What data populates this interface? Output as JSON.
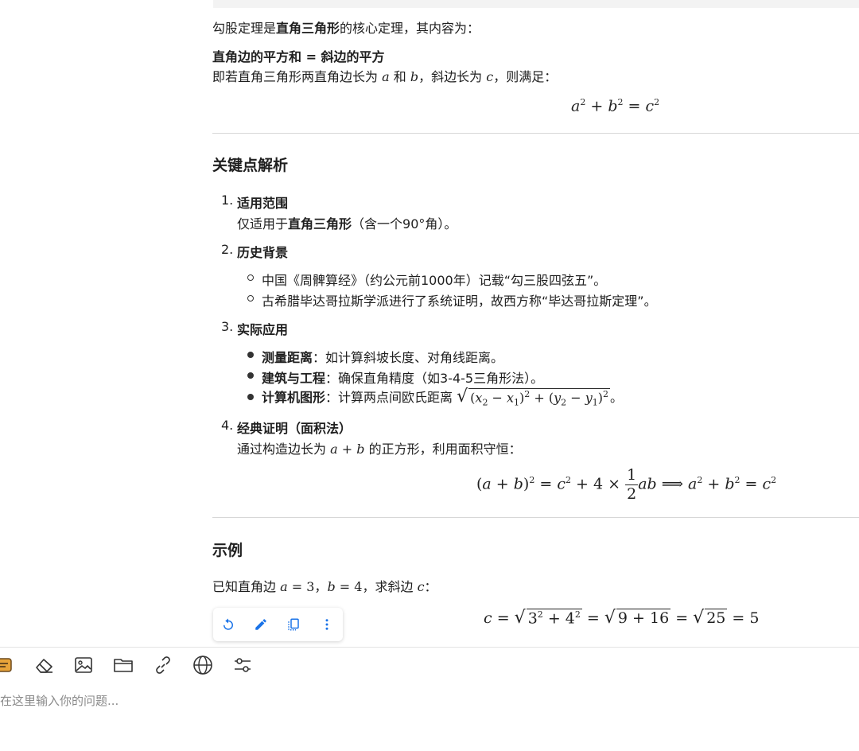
{
  "intro": {
    "prefix": "勾股定理是",
    "bold": "直角三角形",
    "suffix": "的核心定理，其内容为："
  },
  "statement": {
    "bold": "直角边的平方和 = 斜边的平方",
    "line_prefix": "即若直角三角形两直角边长为",
    "and": "和",
    "hyp": "，斜边长为",
    "end": "，则满足："
  },
  "sections": {
    "key_points": "关键点解析",
    "example": "示例"
  },
  "items": [
    {
      "num": "1.",
      "title": "适用范围",
      "desc_prefix": "仅适用于",
      "desc_bold": "直角三角形",
      "desc_suffix": "（含一个90°角）。"
    },
    {
      "num": "2.",
      "title": "历史背景",
      "bullets": [
        "中国《周髀算经》（约公元前1000年）记载“勾三股四弦五”。",
        "古希腊毕达哥拉斯学派进行了系统证明，故西方称“毕达哥拉斯定理”。"
      ]
    },
    {
      "num": "3.",
      "title": "实际应用",
      "bullets": [
        {
          "bold": "测量距离",
          "text": "：如计算斜坡长度、对角线距离。"
        },
        {
          "bold": "建筑与工程",
          "text": "：确保直角精度（如3-4-5三角形法）。"
        },
        {
          "bold": "计算机图形",
          "text": "：计算两点间欧氏距离"
        }
      ]
    },
    {
      "num": "4.",
      "title": "经典证明（面积法）",
      "desc_prefix": "通过构造边长为",
      "desc_suffix": "的正方形，利用面积守恒："
    }
  ],
  "example": {
    "prefix": "已知直角边",
    "sep": "，",
    "mid": "，求斜边",
    "end": "："
  },
  "toolbar": {
    "regenerate": "regenerate-icon",
    "edit": "edit-icon",
    "copy": "copy-icon",
    "more": "more-icon",
    "accent": "#1a73e8"
  },
  "input": {
    "placeholder": "在这里输入你的问题..."
  }
}
